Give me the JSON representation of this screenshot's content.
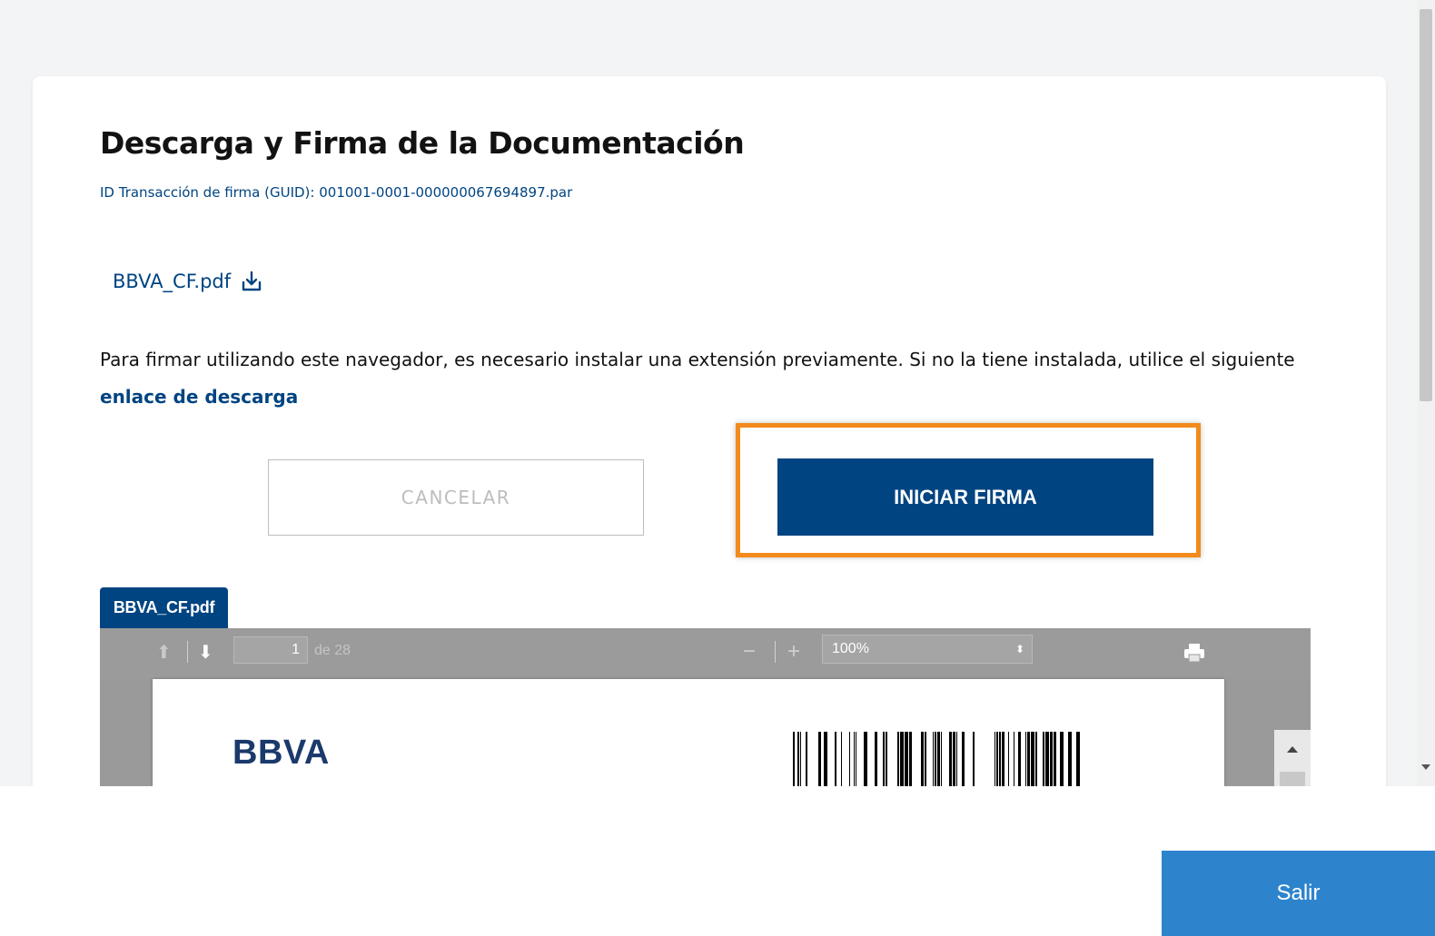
{
  "page": {
    "title": "Descarga y Firma de la Documentación",
    "guid": "ID Transacción de firma (GUID): 001001-0001-000000067694897.par"
  },
  "file": {
    "name": "BBVA_CF.pdf",
    "icon": "download-icon"
  },
  "description": {
    "text": "Para firmar utilizando este navegador, es necesario instalar una extensión previamente. Si no la tiene instalada, utilice el siguiente ",
    "link": "enlace de descarga"
  },
  "actions": {
    "cancel": "CANCELAR",
    "start": "INICIAR FIRMA",
    "highlight_color": "#f28a1c"
  },
  "viewer": {
    "tab": "BBVA_CF.pdf",
    "page_current": "1",
    "page_total": "de 28",
    "zoom": "100%",
    "zoom_out": "−",
    "zoom_in": "+",
    "prev_icon": "arrow-up-icon",
    "next_icon": "arrow-down-icon",
    "print_icon": "printer-icon"
  },
  "document": {
    "logo": "BBVA"
  },
  "footer": {
    "exit": "Salir"
  },
  "colors": {
    "brand": "#004481",
    "exit": "#2d84cd"
  }
}
